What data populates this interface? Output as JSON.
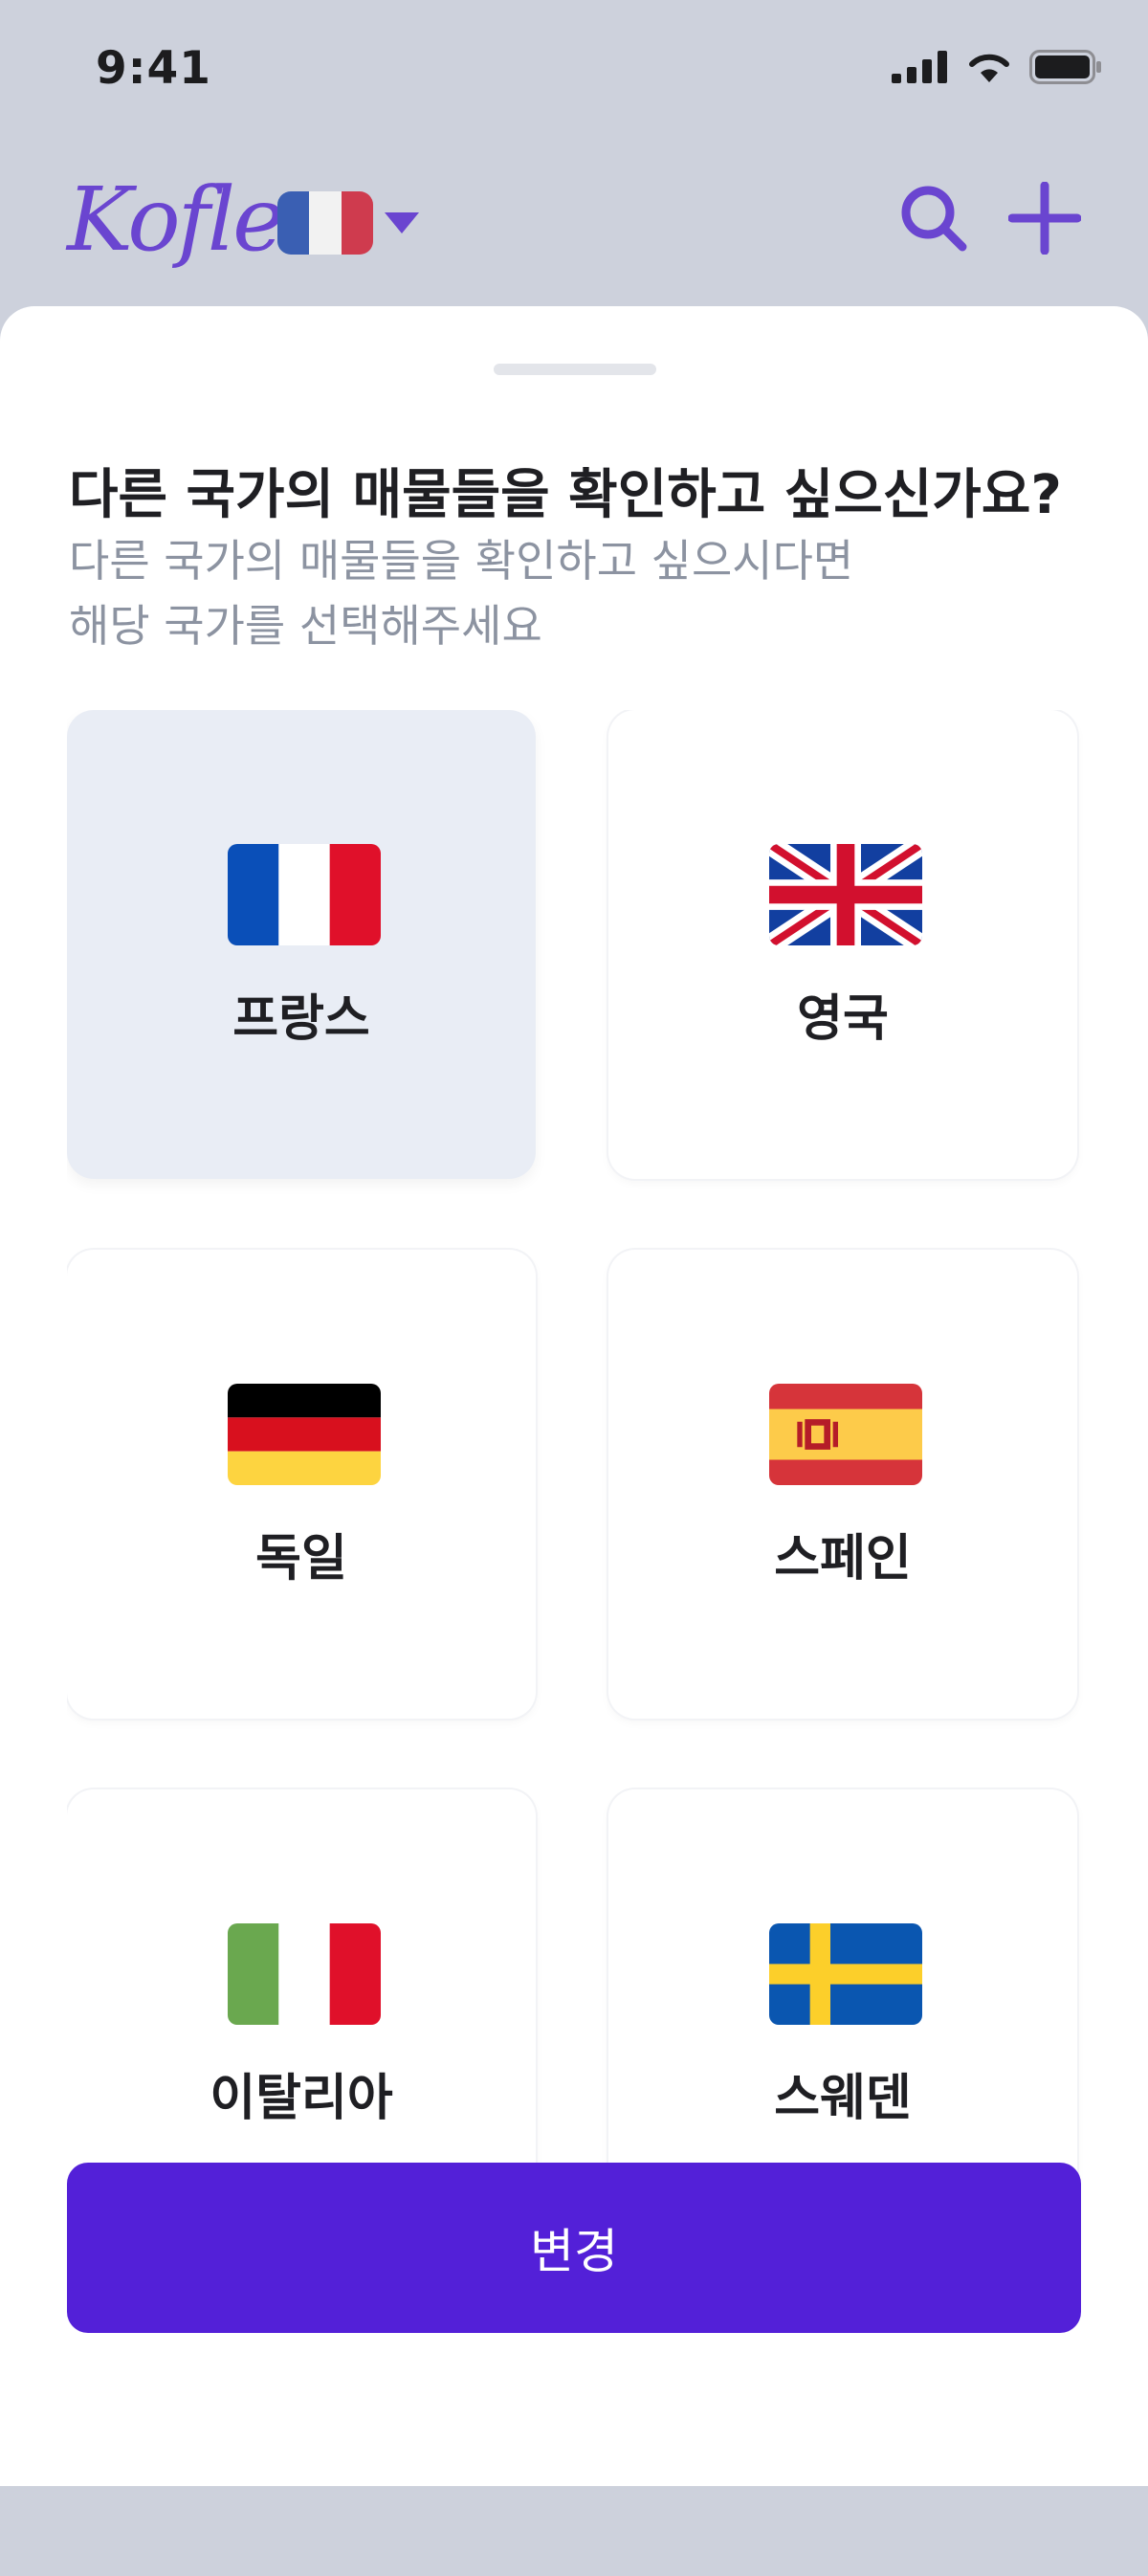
{
  "status_bar": {
    "time": "9:41"
  },
  "header": {
    "logo": "Koflea",
    "current_country_flag": "flag-france"
  },
  "sheet": {
    "title": "다른 국가의 매물들을 확인하고 싶으신가요?",
    "subtitle_line1": "다른 국가의 매물들을 확인하고 싶으시다면",
    "subtitle_line2": "해당 국가를 선택해주세요"
  },
  "countries": [
    {
      "name": "프랑스",
      "flag": "flag-france",
      "selected": true
    },
    {
      "name": "영국",
      "flag": "flag-united-kingdom",
      "selected": false
    },
    {
      "name": "독일",
      "flag": "flag-germany",
      "selected": false
    },
    {
      "name": "스페인",
      "flag": "flag-spain",
      "selected": false
    },
    {
      "name": "이탈리아",
      "flag": "flag-italy",
      "selected": false
    },
    {
      "name": "스웨덴",
      "flag": "flag-sweden",
      "selected": false
    }
  ],
  "actions": {
    "confirm_label": "변경"
  },
  "colors": {
    "brand": "#6a45d0",
    "primary_button": "#5320d8",
    "selected_card": "#e9edf5",
    "muted_text": "#8c93a1"
  }
}
